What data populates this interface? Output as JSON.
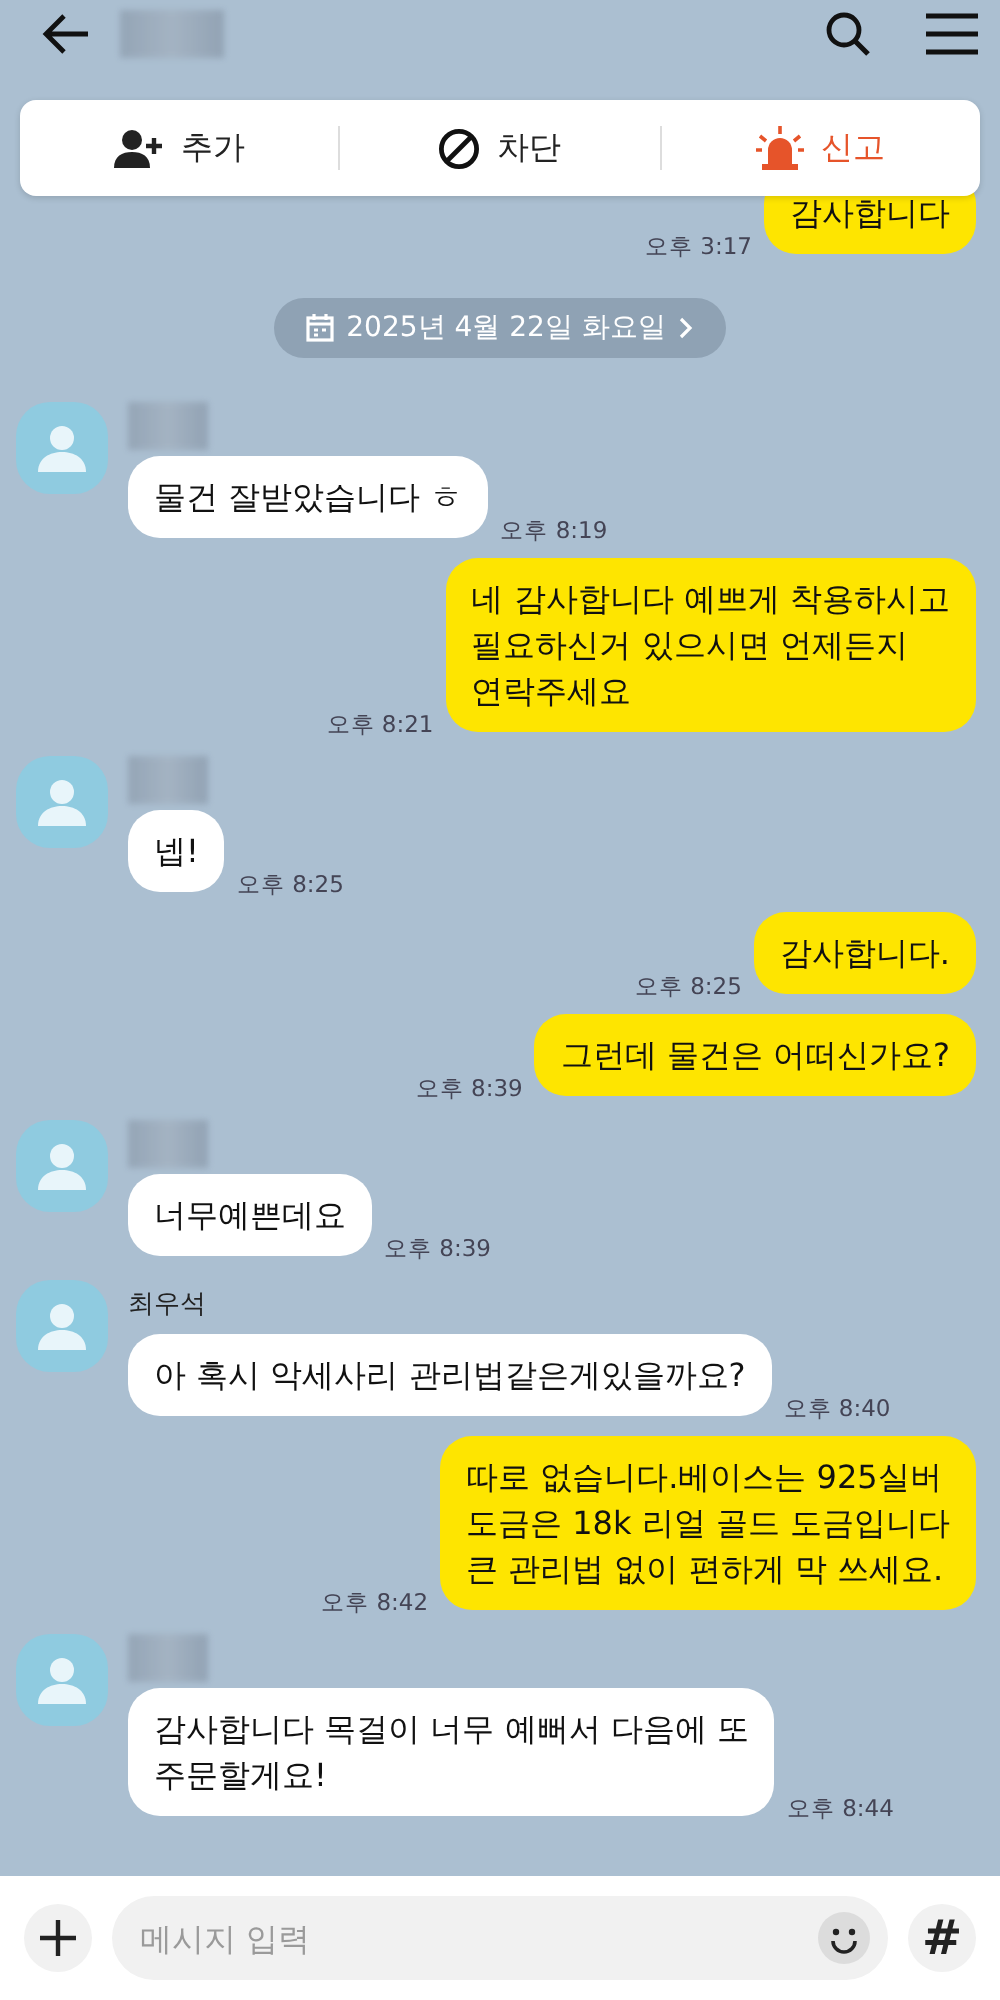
{
  "header": {
    "title_blurred": true
  },
  "action_bar": {
    "items": [
      {
        "kind": "add",
        "label": "추가"
      },
      {
        "kind": "block",
        "label": "차단"
      },
      {
        "kind": "report",
        "label": "신고"
      }
    ]
  },
  "messages": [
    {
      "kind": "sent",
      "text": "감사합니다",
      "time": "오후 3:17"
    },
    {
      "kind": "date",
      "text": "2025년 4월 22일 화요일"
    },
    {
      "kind": "received",
      "avatar": true,
      "name_blurred": true,
      "text": "물건 잘받았습니다 ㅎ",
      "time": "오후 8:19"
    },
    {
      "kind": "sent",
      "text": "네 감사합니다 예쁘게 착용하시고\n필요하신거 있으시면 언제든지\n연락주세요",
      "time": "오후 8:21"
    },
    {
      "kind": "received",
      "avatar": true,
      "name_blurred": true,
      "text": "넵!",
      "time": "오후 8:25"
    },
    {
      "kind": "sent",
      "text": "감사합니다.",
      "time": "오후 8:25"
    },
    {
      "kind": "sent",
      "text": "그런데 물건은 어떠신가요?",
      "time": "오후 8:39"
    },
    {
      "kind": "received",
      "avatar": true,
      "name_blurred": true,
      "text": "너무예쁜데요",
      "time": "오후 8:39"
    },
    {
      "kind": "received",
      "avatar": true,
      "name": "최우석",
      "text": "아 혹시 악세사리 관리법같은게있을까요?",
      "time": "오후 8:40"
    },
    {
      "kind": "sent",
      "text": "따로 없습니다.베이스는 925실버\n도금은 18k 리얼 골드 도금입니다\n큰 관리법 없이 편하게 막 쓰세요.",
      "time": "오후 8:42"
    },
    {
      "kind": "received",
      "avatar": true,
      "name_blurred": true,
      "text": "감사합니다 목걸이 너무 예뻐서 다음에 또\n주문할게요!",
      "time": "오후 8:44"
    }
  ],
  "input_bar": {
    "placeholder": "메시지 입력",
    "hash_label": "#"
  }
}
